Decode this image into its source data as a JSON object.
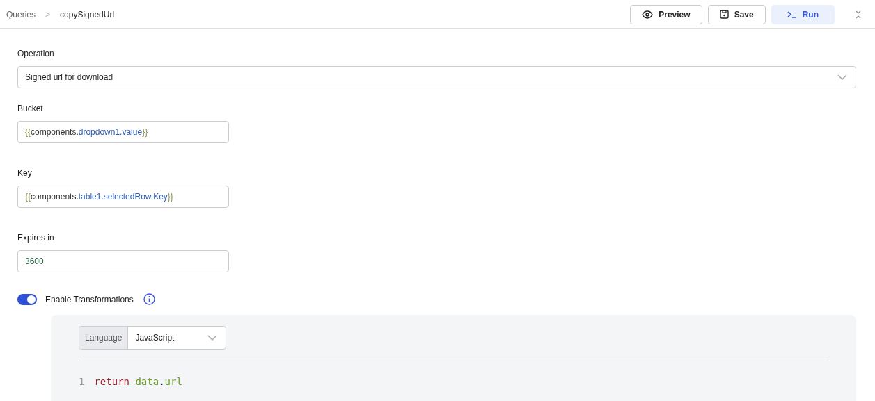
{
  "breadcrumb": {
    "parent": "Queries",
    "separator": ">",
    "current": "copySignedUrl"
  },
  "actions": [
    {
      "kind": "preview",
      "label": "Preview"
    },
    {
      "kind": "save",
      "label": "Save"
    },
    {
      "kind": "run",
      "label": "Run"
    }
  ],
  "operation": {
    "label": "Operation",
    "value": "Signed url for download"
  },
  "fields": [
    {
      "label": "Bucket",
      "parts": [
        {
          "kind": "brace",
          "text": "{{"
        },
        {
          "kind": "plain",
          "text": "components."
        },
        {
          "kind": "ref",
          "text": "dropdown1.value"
        },
        {
          "kind": "brace",
          "text": "}}"
        }
      ]
    },
    {
      "label": "Key",
      "parts": [
        {
          "kind": "brace",
          "text": "{{"
        },
        {
          "kind": "plain",
          "text": "components."
        },
        {
          "kind": "ref",
          "text": "table1.selectedRow.Key"
        },
        {
          "kind": "brace",
          "text": "}}"
        }
      ]
    },
    {
      "label": "Expires in",
      "parts": [
        {
          "kind": "number",
          "text": "3600"
        }
      ]
    }
  ],
  "transformations": {
    "label": "Enable Transformations",
    "on": true
  },
  "editor": {
    "language_label": "Language",
    "language": "JavaScript",
    "lines": [
      {
        "number": "1",
        "tokens": [
          {
            "kind": "keyword",
            "text": "return"
          },
          {
            "kind": "var",
            "text": "data"
          },
          {
            "kind": "punct",
            "text": "."
          },
          {
            "kind": "var",
            "text": "url"
          }
        ]
      }
    ]
  }
}
